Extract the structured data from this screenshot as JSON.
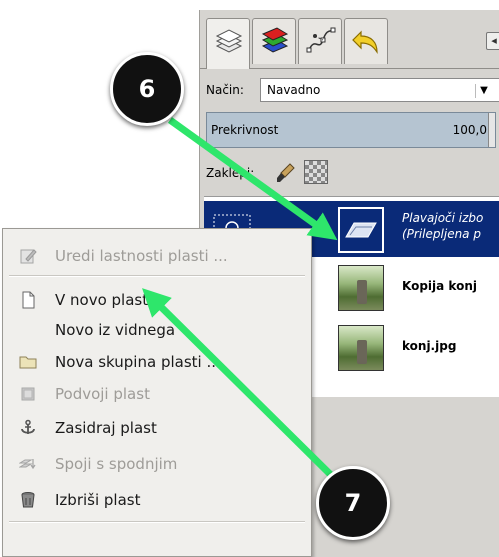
{
  "dock": {
    "tabs": [
      {
        "name": "layers",
        "icon": "layers-stack-icon"
      },
      {
        "name": "channels",
        "icon": "channels-icon"
      },
      {
        "name": "paths",
        "icon": "paths-icon"
      },
      {
        "name": "undo",
        "icon": "undo-history-icon"
      }
    ],
    "mode_label": "Način:",
    "mode_value": "Navadno",
    "opacity_label": "Prekrivnost",
    "opacity_value": "100,0",
    "lock_label": "Zaklepi:",
    "layers": [
      {
        "name": "Plavajoči izbor\n(Prilepljena plast)",
        "line1": "Plavajoči izbo",
        "line2": "(Prilepljena p",
        "selected": true
      },
      {
        "name": "Kopija konj",
        "selected": false
      },
      {
        "name": "konj.jpg",
        "selected": false
      }
    ]
  },
  "menu": {
    "items": [
      {
        "label": "Uredi lastnosti plasti ...",
        "icon": "edit-properties-icon",
        "disabled": true
      },
      {
        "label": "V novo plast",
        "icon": "new-layer-icon",
        "disabled": false
      },
      {
        "label": "Novo iz vidnega",
        "icon": "",
        "disabled": false
      },
      {
        "label": "Nova skupina plasti ...",
        "icon": "folder-icon",
        "disabled": false
      },
      {
        "label": "Podvoji plast",
        "icon": "duplicate-icon",
        "disabled": true
      },
      {
        "label": "Zasidraj plast",
        "icon": "anchor-icon",
        "disabled": false
      },
      {
        "label": "Spoji s spodnjim",
        "icon": "merge-down-icon",
        "disabled": true
      },
      {
        "label": "Izbriši plast",
        "icon": "trash-icon",
        "disabled": false
      }
    ]
  },
  "callouts": [
    {
      "number": "6"
    },
    {
      "number": "7"
    }
  ],
  "colors": {
    "arrow": "#2ee66b",
    "selected_layer_bg": "#0a2a78",
    "badge_bg": "#111111"
  }
}
